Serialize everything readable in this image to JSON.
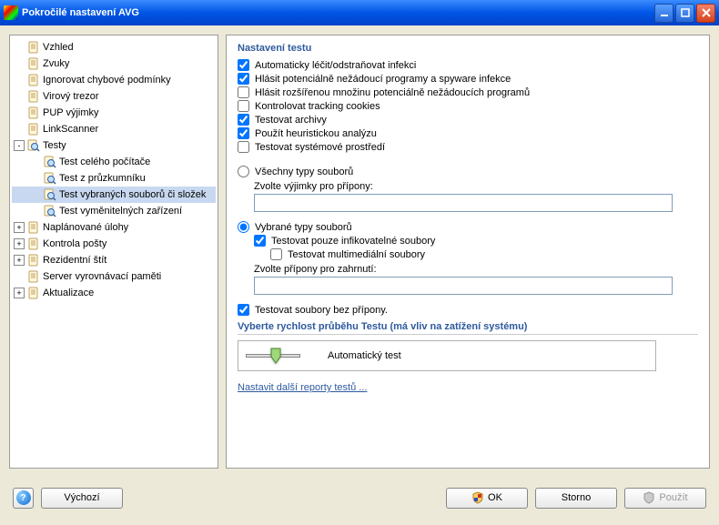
{
  "titlebar": {
    "title": "Pokročilé nastavení AVG"
  },
  "tree": {
    "items": [
      {
        "label": "Vzhled",
        "depth": 1,
        "icon": "page",
        "exp": ""
      },
      {
        "label": "Zvuky",
        "depth": 1,
        "icon": "page",
        "exp": ""
      },
      {
        "label": "Ignorovat chybové podmínky",
        "depth": 1,
        "icon": "page",
        "exp": ""
      },
      {
        "label": "Virový trezor",
        "depth": 1,
        "icon": "page",
        "exp": ""
      },
      {
        "label": "PUP výjimky",
        "depth": 1,
        "icon": "page",
        "exp": ""
      },
      {
        "label": "LinkScanner",
        "depth": 1,
        "icon": "page",
        "exp": ""
      },
      {
        "label": "Testy",
        "depth": 1,
        "icon": "mag",
        "exp": "-"
      },
      {
        "label": "Test celého počítače",
        "depth": 2,
        "icon": "mag",
        "exp": ""
      },
      {
        "label": "Test z průzkumníku",
        "depth": 2,
        "icon": "mag",
        "exp": ""
      },
      {
        "label": "Test vybraných souborů či složek",
        "depth": 2,
        "icon": "mag",
        "exp": "",
        "selected": true
      },
      {
        "label": "Test vyměnitelných zařízení",
        "depth": 2,
        "icon": "mag",
        "exp": ""
      },
      {
        "label": "Naplánované úlohy",
        "depth": 1,
        "icon": "page",
        "exp": "+"
      },
      {
        "label": "Kontrola pošty",
        "depth": 1,
        "icon": "page",
        "exp": "+"
      },
      {
        "label": "Rezidentní štít",
        "depth": 1,
        "icon": "page",
        "exp": "+"
      },
      {
        "label": "Server vyrovnávací paměti",
        "depth": 1,
        "icon": "page",
        "exp": ""
      },
      {
        "label": "Aktualizace",
        "depth": 1,
        "icon": "page",
        "exp": "+"
      }
    ]
  },
  "panel": {
    "section_title": "Nastavení testu",
    "checks": [
      {
        "label": "Automaticky léčit/odstraňovat infekci",
        "checked": true
      },
      {
        "label": "Hlásit potenciálně nežádoucí programy a spyware infekce",
        "checked": true
      },
      {
        "label": "Hlásit rozšířenou množinu potenciálně nežádoucích programů",
        "checked": false
      },
      {
        "label": "Kontrolovat tracking cookies",
        "checked": false
      },
      {
        "label": "Testovat archivy",
        "checked": true
      },
      {
        "label": "Použít heuristickou analýzu",
        "checked": true
      },
      {
        "label": "Testovat systémové prostředí",
        "checked": false
      }
    ],
    "radio_all": "Všechny typy souborů",
    "radio_sel": "Vybrané typy souborů",
    "radio_value": "sel",
    "excl_label": "Zvolte výjimky pro přípony:",
    "excl_value": "",
    "chk_infect": {
      "label": "Testovat pouze infikovatelné soubory",
      "checked": true
    },
    "chk_multi": {
      "label": "Testovat multimediální soubory",
      "checked": false
    },
    "incl_label": "Zvolte přípony pro zahrnutí:",
    "incl_value": "",
    "chk_noext": {
      "label": "Testovat soubory bez přípony.",
      "checked": true
    },
    "speed_title": "Vyberte rychlost průběhu Testu (má vliv na zatížení systému)",
    "speed_label": "Automatický test",
    "link": "Nastavit další reporty testů ..."
  },
  "footer": {
    "default": "Výchozí",
    "ok": "OK",
    "cancel": "Storno",
    "apply": "Použít"
  }
}
